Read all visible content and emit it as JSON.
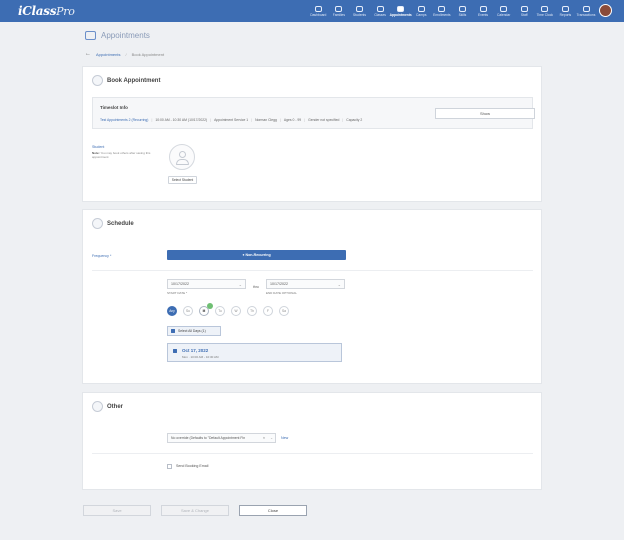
{
  "app": {
    "logo_main": "iClass",
    "logo_suffix": "Pro"
  },
  "nav": [
    {
      "label": "Dashboard",
      "icon": "dashboard-icon"
    },
    {
      "label": "Families",
      "icon": "families-icon"
    },
    {
      "label": "Students",
      "icon": "students-icon"
    },
    {
      "label": "Classes",
      "icon": "classes-icon"
    },
    {
      "label": "Appointments",
      "icon": "appointments-icon",
      "active": true
    },
    {
      "label": "Camps",
      "icon": "camps-icon"
    },
    {
      "label": "Enrollments",
      "icon": "enrollments-icon"
    },
    {
      "label": "Skills",
      "icon": "skills-icon"
    },
    {
      "label": "Events",
      "icon": "events-icon"
    },
    {
      "label": "Calendar",
      "icon": "calendar-icon"
    },
    {
      "label": "Staff",
      "icon": "staff-icon"
    },
    {
      "label": "Time Clock",
      "icon": "time-clock-icon"
    },
    {
      "label": "Reports",
      "icon": "reports-icon"
    },
    {
      "label": "Transactions",
      "icon": "transactions-icon"
    }
  ],
  "page": {
    "title": "Appointments"
  },
  "breadcrumb": {
    "parent": "Appointments",
    "separator": "/",
    "current": "Book Appointment"
  },
  "book": {
    "title": "Book Appointment",
    "timeslot_title": "Timeslot Info",
    "timeslot_name": "Test Appointments 2 (Recurring)",
    "timeslot_details": [
      "10:00 AM - 10:30 AM (10/17/2022)",
      "Appointment Service 1",
      "Norman Clegg",
      "Ages 0 - 99",
      "Gender not specified",
      "Capacity 2"
    ],
    "show_label": "Show",
    "student_label": "Student",
    "student_note_bold": "Note:",
    "student_note": "You may book others after saving this appointment",
    "select_student_label": "Select Student"
  },
  "schedule": {
    "title": "Schedule",
    "frequency_label": "Frequency *",
    "frequency_value": "Non-Recurring",
    "start_date": "10/17/2022",
    "start_label": "START DATE *",
    "thru_label": "thru",
    "end_date": "10/17/2022",
    "end_label": "END DATE OPTIONAL",
    "days": [
      "Any",
      "Su",
      "M",
      "Tu",
      "W",
      "Th",
      "F",
      "Sa"
    ],
    "select_all_label": "Select All Days (1)",
    "occurrence_date": "Oct 17, 2022",
    "occurrence_time": "Mon  ·  10:00 AM - 10:30 AM"
  },
  "other": {
    "title": "Other",
    "override_value": "No override (Defaults to \"Default Appointment Fin",
    "override_x": "×",
    "new_label": "New",
    "send_email_label": "Send Booking Email"
  },
  "footer": {
    "save_label": "Save",
    "save_change_label": "Save & Change",
    "close_label": "Close"
  }
}
